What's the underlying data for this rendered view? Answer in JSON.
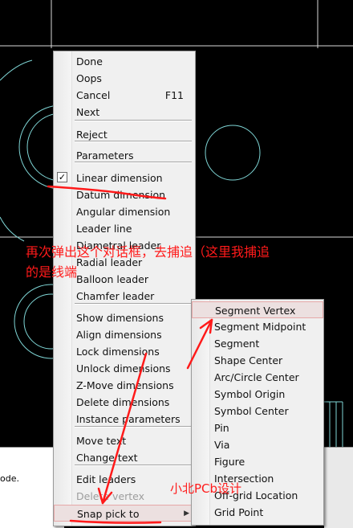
{
  "status_text": "ode.",
  "main_menu": {
    "items": [
      {
        "label": "Done",
        "shortcut": "",
        "checked": false,
        "disabled": false
      },
      {
        "label": "Oops",
        "shortcut": "",
        "checked": false,
        "disabled": false
      },
      {
        "label": "Cancel",
        "shortcut": "F11",
        "checked": false,
        "disabled": false
      },
      {
        "label": "Next",
        "shortcut": "",
        "checked": false,
        "disabled": false
      },
      {
        "label": "Reject",
        "shortcut": "",
        "checked": false,
        "disabled": false
      },
      {
        "label": "Parameters",
        "shortcut": "",
        "checked": false,
        "disabled": false
      },
      {
        "label": "Linear dimension",
        "shortcut": "",
        "checked": true,
        "disabled": false
      },
      {
        "label": "Datum dimension",
        "shortcut": "",
        "checked": false,
        "disabled": false
      },
      {
        "label": "Angular dimension",
        "shortcut": "",
        "checked": false,
        "disabled": false
      },
      {
        "label": "Leader line",
        "shortcut": "",
        "checked": false,
        "disabled": false
      },
      {
        "label": "Diametral leader",
        "shortcut": "",
        "checked": false,
        "disabled": false
      },
      {
        "label": "Radial leader",
        "shortcut": "",
        "checked": false,
        "disabled": false
      },
      {
        "label": "Balloon leader",
        "shortcut": "",
        "checked": false,
        "disabled": false
      },
      {
        "label": "Chamfer leader",
        "shortcut": "",
        "checked": false,
        "disabled": false
      },
      {
        "label": "Show dimensions",
        "shortcut": "",
        "checked": false,
        "disabled": false
      },
      {
        "label": "Align dimensions",
        "shortcut": "",
        "checked": false,
        "disabled": false
      },
      {
        "label": "Lock dimensions",
        "shortcut": "",
        "checked": false,
        "disabled": false
      },
      {
        "label": "Unlock dimensions",
        "shortcut": "",
        "checked": false,
        "disabled": false
      },
      {
        "label": "Z-Move dimensions",
        "shortcut": "",
        "checked": false,
        "disabled": false
      },
      {
        "label": "Delete dimensions",
        "shortcut": "",
        "checked": false,
        "disabled": false
      },
      {
        "label": "Instance parameters",
        "shortcut": "",
        "checked": false,
        "disabled": false
      },
      {
        "label": "Move text",
        "shortcut": "",
        "checked": false,
        "disabled": false
      },
      {
        "label": "Change text",
        "shortcut": "",
        "checked": false,
        "disabled": false
      },
      {
        "label": "Edit leaders",
        "shortcut": "",
        "checked": false,
        "disabled": false
      },
      {
        "label": "Delete vertex",
        "shortcut": "",
        "checked": false,
        "disabled": true
      },
      {
        "label": "Snap pick to",
        "shortcut": "",
        "checked": false,
        "disabled": false,
        "submenu": true,
        "highlighted": true
      }
    ]
  },
  "snap_submenu": {
    "items": [
      {
        "label": "Segment Vertex",
        "highlighted": true
      },
      {
        "label": "Segment Midpoint"
      },
      {
        "label": "Segment"
      },
      {
        "label": "Shape Center"
      },
      {
        "label": "Arc/Circle Center"
      },
      {
        "label": "Symbol Origin"
      },
      {
        "label": "Symbol Center"
      },
      {
        "label": "Pin"
      },
      {
        "label": "Via"
      },
      {
        "label": "Figure"
      },
      {
        "label": "Intersection"
      },
      {
        "label": "Off-grid Location"
      },
      {
        "label": "Grid Point"
      }
    ]
  },
  "annotations": {
    "line1": "再次弹出这个对话框，去捕追（这里我捕追",
    "line2": "的是线端",
    "watermark": "小北PCb设计"
  },
  "colors": {
    "canvas_bg": "#000000",
    "cad_lines": "#7fd6d6",
    "grid_white": "#d8d8d8",
    "annotation_red": "#ff1a1a",
    "menu_bg": "#f0f0f0",
    "highlight_bg": "#ece0e0"
  },
  "icons": {
    "check": "check-icon",
    "submenu": "submenu-arrow-icon"
  }
}
